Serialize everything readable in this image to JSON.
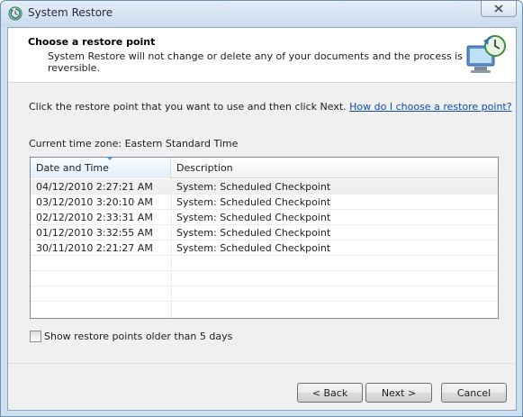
{
  "window": {
    "title": "System Restore",
    "close_label": "×"
  },
  "header": {
    "title": "Choose a restore point",
    "subtitle": "System Restore will not change or delete any of your documents and the process is reversible."
  },
  "body": {
    "instruction": "Click the restore point that you want to use and then click Next.",
    "help_link": "How do I choose a restore point?",
    "timezone": "Current time zone: Eastern Standard Time"
  },
  "list": {
    "columns": [
      "Date and Time",
      "Description"
    ],
    "rows": [
      {
        "date": "04/12/2010 2:27:21 AM",
        "description": "System: Scheduled Checkpoint"
      },
      {
        "date": "03/12/2010 3:20:10 AM",
        "description": "System: Scheduled Checkpoint"
      },
      {
        "date": "02/12/2010 2:33:31 AM",
        "description": "System: Scheduled Checkpoint"
      },
      {
        "date": "01/12/2010 3:32:55 AM",
        "description": "System: Scheduled Checkpoint"
      },
      {
        "date": "30/11/2010 2:21:27 AM",
        "description": "System: Scheduled Checkpoint"
      }
    ]
  },
  "options": {
    "show_older_label": "Show restore points older than 5 days",
    "show_older_checked": false
  },
  "buttons": {
    "back": "< Back",
    "next": "Next >",
    "cancel": "Cancel"
  },
  "icons": {
    "title_icon": "system-restore-icon",
    "header_icon": "system-restore-clock-icon"
  }
}
